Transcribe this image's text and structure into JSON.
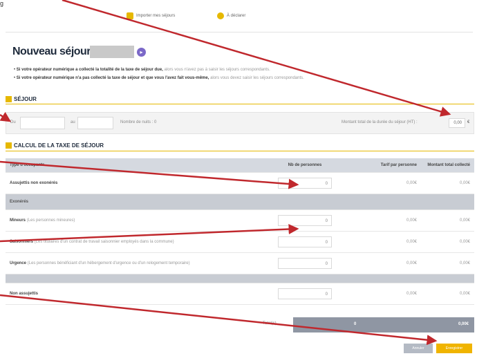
{
  "corner_letter": "g",
  "top": {
    "btn1_label": "Importer mes séjours",
    "btn2_label": "À déclarer"
  },
  "title": "Nouveau séjour :",
  "bullets": [
    {
      "bold": "Si votre opérateur numérique a collecté la totalité de la taxe de séjour due,",
      "light": " alors vous n'avez pas à saisir les séjours correspondants."
    },
    {
      "bold": "Si votre opérateur numérique n'a pas collecté la taxe de séjour et que vous l'avez fait vous-même,",
      "light": " alors vous devez saisir les séjours correspondants."
    }
  ],
  "sejour": {
    "heading": "SÉJOUR",
    "du_label": "Du",
    "au_label": "au",
    "nuits_label": "Nombre de nuits : 0",
    "montant_label": "Montant total de la durée du séjour (HT) :",
    "montant_value": "0,00",
    "euro": "€"
  },
  "calc": {
    "heading": "CALCUL DE LA TAXE DE SÉJOUR",
    "columns": [
      "Type d'occupants",
      "Nb de personnes",
      "Tarif par personne",
      "Montant total collecté"
    ],
    "row_assujettis": {
      "label": "Assujettis non exonérés",
      "count": "0",
      "tarif": "0,00€",
      "total": "0,00€"
    },
    "group_exoneres": "Exonérés",
    "row_mineurs": {
      "label": "Mineurs",
      "desc": " (Les personnes mineures)",
      "count": "0",
      "tarif": "0,00€",
      "total": "0,00€"
    },
    "row_saisonniers": {
      "label": "Saisonniers",
      "desc": " (Les titulaires d'un contrat de travail saisonnier employés dans la commune)",
      "count": "0",
      "tarif": "0,00€",
      "total": "0,00€"
    },
    "row_urgence": {
      "label": "Urgence",
      "desc": " (Les personnes bénéficiant d'un hébergement d'urgence ou d'un relogement temporaire)",
      "count": "0",
      "tarif": "0,00€",
      "total": "0,00€"
    },
    "row_non_assujettis": {
      "label": "Non assujettis",
      "count": "0",
      "tarif": "0,00€",
      "total": "0,00€"
    },
    "total_label": "Total(s)",
    "total_count": "0",
    "total_amount": "0,00€"
  },
  "buttons": {
    "cancel": "Annuler",
    "save": "Enregistrer"
  },
  "colors": {
    "accent": "#e6b800",
    "arrow": "#c0282d",
    "title": "#1f2b3c",
    "header_grey": "#d5d9e0"
  }
}
